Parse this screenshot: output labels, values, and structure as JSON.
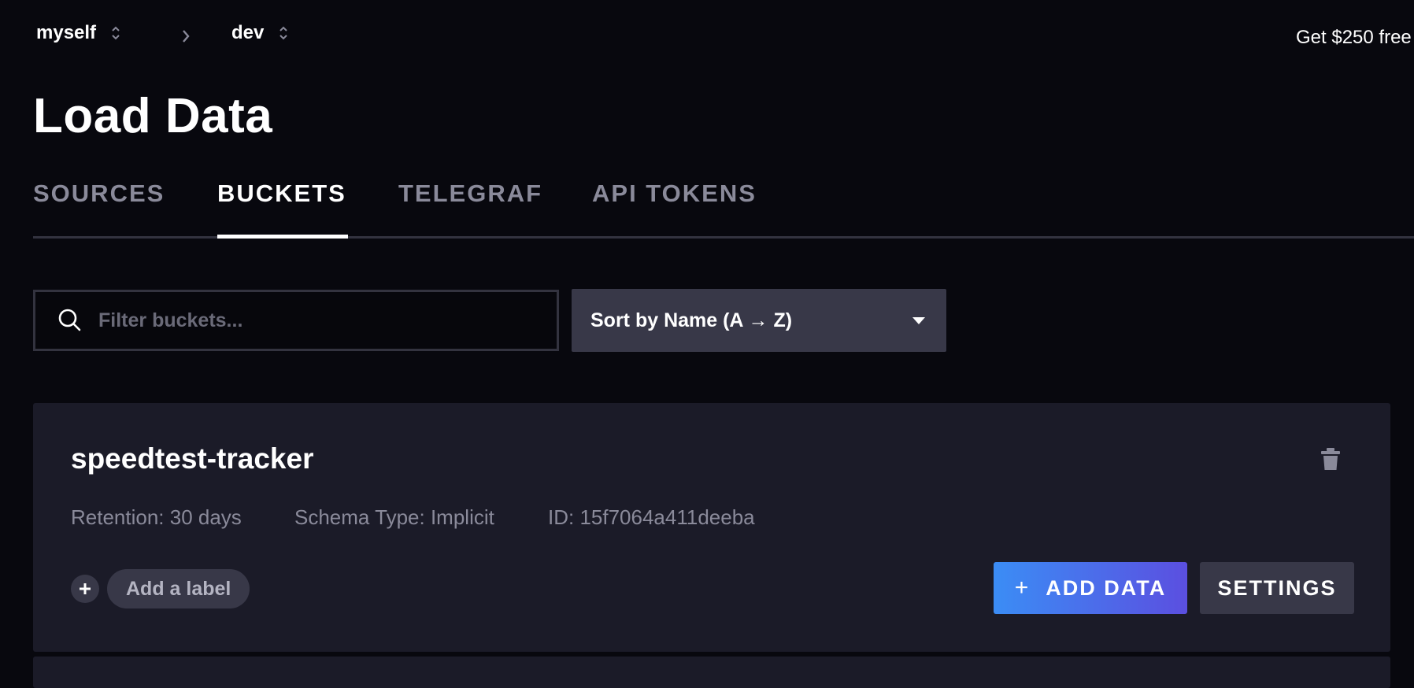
{
  "breadcrumb": {
    "org": "myself",
    "bucket": "dev",
    "icons": {
      "switcher": "chevron-updown-icon",
      "separator": "chevron-right-icon"
    }
  },
  "promo": {
    "text": "Get $250 free"
  },
  "page": {
    "title": "Load Data"
  },
  "tabs": [
    {
      "label": "SOURCES",
      "active": false
    },
    {
      "label": "BUCKETS",
      "active": true
    },
    {
      "label": "TELEGRAF",
      "active": false
    },
    {
      "label": "API TOKENS",
      "active": false
    }
  ],
  "filter": {
    "placeholder": "Filter buckets...",
    "value": "",
    "icon": "search-icon"
  },
  "sort": {
    "label": "Sort by Name (A → Z)",
    "icon": "caret-down-icon"
  },
  "buckets": [
    {
      "name": "speedtest-tracker",
      "retention": "Retention: 30 days",
      "schema": "Schema Type: Implicit",
      "id": "ID: 15f7064a411deeba",
      "add_label": "Add a label",
      "add_data": "ADD DATA",
      "settings": "SETTINGS",
      "delete_icon": "trash-icon"
    }
  ],
  "colors": {
    "background": "#08080e",
    "card": "#1b1b28",
    "control": "#383848",
    "muted_text": "#8a8a9a",
    "accent_start": "#3b8df5",
    "accent_end": "#5b4fe0"
  }
}
